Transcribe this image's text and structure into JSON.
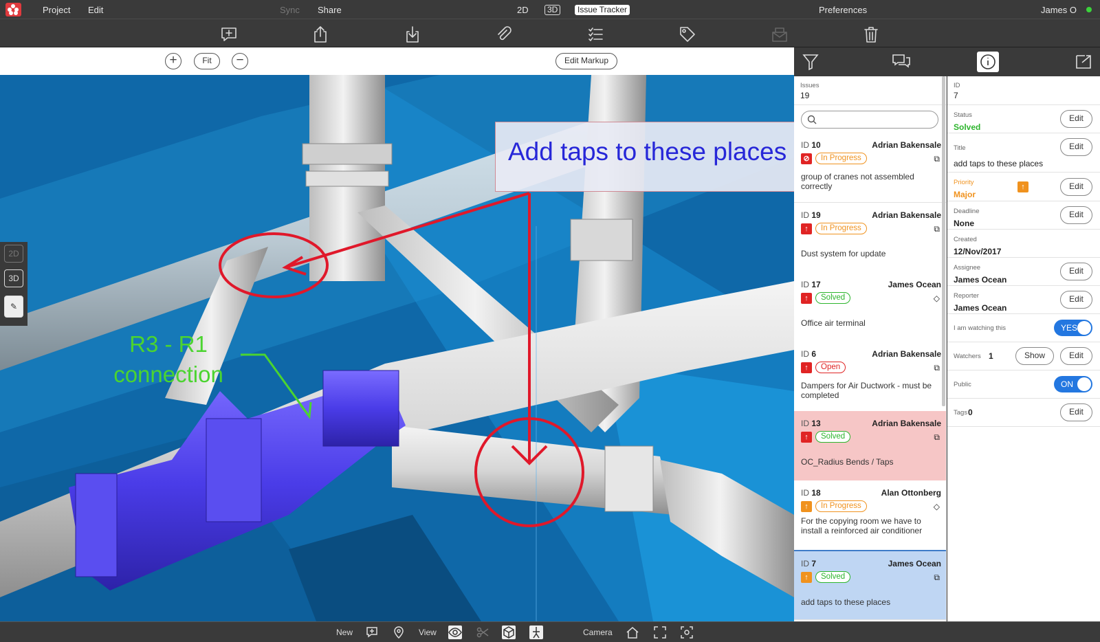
{
  "menubar": {
    "project": "Project",
    "edit": "Edit",
    "sync": "Sync",
    "share": "Share",
    "view_2d": "2D",
    "view_3d": "3D",
    "issue_tracker": "Issue Tracker",
    "preferences": "Preferences",
    "user": "James O"
  },
  "canvas_toolbar": {
    "fit": "Fit",
    "edit_markup": "Edit Markup"
  },
  "markup": {
    "callout": "Add taps to these places",
    "note_line1": "R3 - R1",
    "note_line2": "connection"
  },
  "side_tools": {
    "btn_2d": "2D",
    "btn_3d": "3D"
  },
  "issues": {
    "label": "Issues",
    "count": "19",
    "list": [
      {
        "id_label": "ID",
        "id": "10",
        "assignee": "Adrian Bakensale",
        "status": "In Progress",
        "title": "group of cranes not assembled correctly"
      },
      {
        "id_label": "ID",
        "id": "19",
        "assignee": "Adrian Bakensale",
        "status": "In Progress",
        "title": "Dust system for update"
      },
      {
        "id_label": "ID",
        "id": "17",
        "assignee": "James Ocean",
        "status": "Solved",
        "title": "Office air terminal"
      },
      {
        "id_label": "ID",
        "id": "6",
        "assignee": "Adrian Bakensale",
        "status": "Open",
        "title": "Dampers for Air Ductwork - must be completed"
      },
      {
        "id_label": "ID",
        "id": "13",
        "assignee": "Adrian Bakensale",
        "status": "Solved",
        "title": "OC_Radius Bends / Taps"
      },
      {
        "id_label": "ID",
        "id": "18",
        "assignee": "Alan Ottonberg",
        "status": "In Progress",
        "title": "For the copying room we have to install a reinforced air conditioner"
      },
      {
        "id_label": "ID",
        "id": "7",
        "assignee": "James Ocean",
        "status": "Solved",
        "title": "add taps to these places"
      }
    ]
  },
  "details": {
    "id_label": "ID",
    "id": "7",
    "status_label": "Status",
    "status": "Solved",
    "title_label": "Title",
    "title": "add taps to these places",
    "priority_label": "Priority",
    "priority": "Major",
    "deadline_label": "Deadline",
    "deadline": "None",
    "created_label": "Created",
    "created": "12/Nov/2017",
    "assignee_label": "Assignee",
    "assignee": "James Ocean",
    "reporter_label": "Reporter",
    "reporter": "James Ocean",
    "watching_label": "I am watching this",
    "watching_toggle": "YES",
    "watchers_label": "Watchers",
    "watchers_count": "1",
    "public_label": "Public",
    "public_toggle": "ON",
    "tags_label": "Tags",
    "tags_count": "0",
    "edit": "Edit",
    "show": "Show"
  },
  "bottombar": {
    "new": "New",
    "view": "View",
    "camera": "Camera"
  },
  "colors": {
    "brand": "#e03a3e",
    "in_progress": "#f0921e",
    "solved": "#2db52d",
    "open": "#e02424",
    "selected_row": "#bfd6f3",
    "alert_row": "#f6c6c6",
    "toggle_on": "#2377e0",
    "markup_red": "#e0182a",
    "markup_blue": "#2727d8",
    "markup_green": "#4bd430"
  },
  "icons": {
    "toolbar": [
      "add-comment-icon",
      "upload-icon",
      "download-icon",
      "attach-icon",
      "checklist-icon",
      "tag-icon",
      "mail-icon",
      "trash-icon"
    ],
    "panel_tabs": [
      "filter-icon",
      "comments-icon",
      "info-icon",
      "popout-icon"
    ]
  }
}
